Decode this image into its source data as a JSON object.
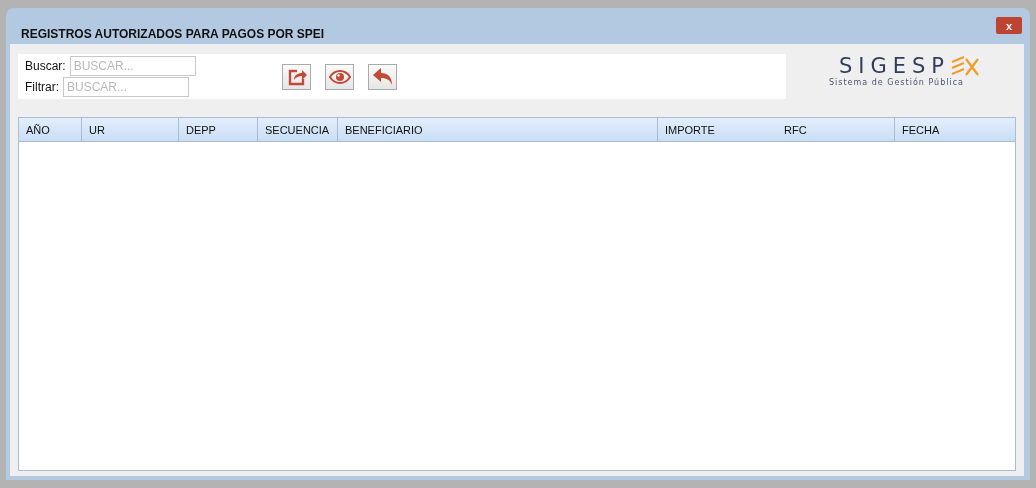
{
  "window": {
    "title": "REGISTROS AUTORIZADOS PARA PAGOS POR SPEI",
    "close": "x"
  },
  "filters": [
    {
      "label": "Buscar:",
      "placeholder": "BUSCAR..."
    },
    {
      "label": "Filtrar:",
      "placeholder": "BUSCAR..."
    }
  ],
  "actions": [
    {
      "kind": "export"
    },
    {
      "kind": "view"
    },
    {
      "kind": "back"
    }
  ],
  "logo": {
    "name": "SIGESP",
    "subtitle": "Sistema de Gestión Pública"
  },
  "table": {
    "columns": [
      {
        "label": "AÑO",
        "divider": true
      },
      {
        "label": "UR",
        "divider": true
      },
      {
        "label": "DEPP",
        "divider": true
      },
      {
        "label": "SECUENCIA",
        "divider": true
      },
      {
        "label": "BENEFICIARIO",
        "divider": true
      },
      {
        "label": "IMPORTE",
        "divider": false
      },
      {
        "label": "RFC",
        "divider": true
      },
      {
        "label": "FECHA",
        "divider": false
      }
    ]
  }
}
